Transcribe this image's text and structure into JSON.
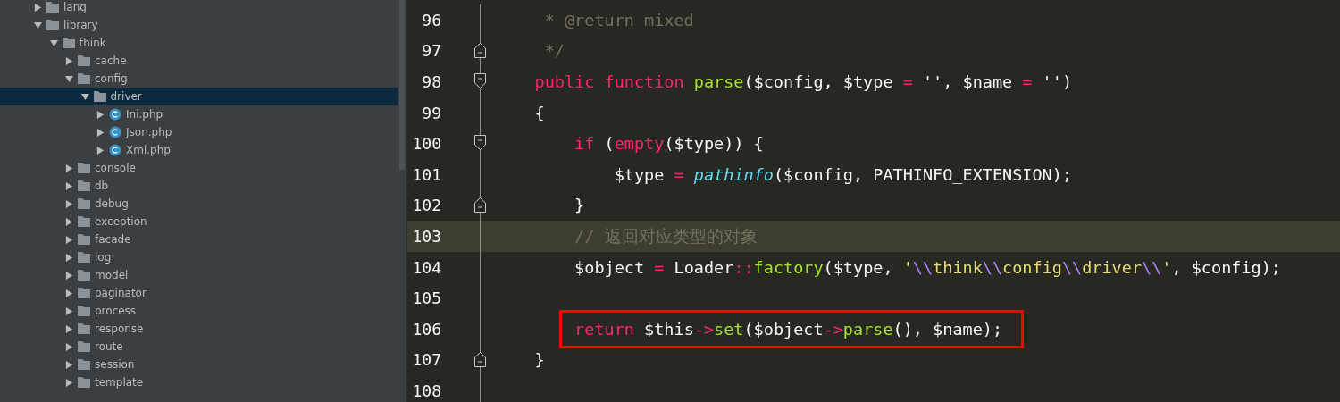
{
  "project_tree": [
    {
      "label": "lang",
      "kind": "folder",
      "expanded": false,
      "selected": false
    },
    {
      "label": "library",
      "kind": "folder",
      "expanded": true,
      "selected": false,
      "children": [
        {
          "label": "think",
          "kind": "folder",
          "expanded": true,
          "selected": false,
          "children": [
            {
              "label": "cache",
              "kind": "folder",
              "expanded": false,
              "selected": false
            },
            {
              "label": "config",
              "kind": "folder",
              "expanded": true,
              "selected": false,
              "children": [
                {
                  "label": "driver",
                  "kind": "folder",
                  "expanded": true,
                  "selected": true,
                  "children": [
                    {
                      "label": "Ini.php",
                      "kind": "class",
                      "expanded": false,
                      "selected": false
                    },
                    {
                      "label": "Json.php",
                      "kind": "class",
                      "expanded": false,
                      "selected": false
                    },
                    {
                      "label": "Xml.php",
                      "kind": "class",
                      "expanded": false,
                      "selected": false
                    }
                  ]
                }
              ]
            },
            {
              "label": "console",
              "kind": "folder",
              "expanded": false,
              "selected": false
            },
            {
              "label": "db",
              "kind": "folder",
              "expanded": false,
              "selected": false
            },
            {
              "label": "debug",
              "kind": "folder",
              "expanded": false,
              "selected": false
            },
            {
              "label": "exception",
              "kind": "folder",
              "expanded": false,
              "selected": false
            },
            {
              "label": "facade",
              "kind": "folder",
              "expanded": false,
              "selected": false
            },
            {
              "label": "log",
              "kind": "folder",
              "expanded": false,
              "selected": false
            },
            {
              "label": "model",
              "kind": "folder",
              "expanded": false,
              "selected": false
            },
            {
              "label": "paginator",
              "kind": "folder",
              "expanded": false,
              "selected": false
            },
            {
              "label": "process",
              "kind": "folder",
              "expanded": false,
              "selected": false
            },
            {
              "label": "response",
              "kind": "folder",
              "expanded": false,
              "selected": false
            },
            {
              "label": "route",
              "kind": "folder",
              "expanded": false,
              "selected": false
            },
            {
              "label": "session",
              "kind": "folder",
              "expanded": false,
              "selected": false
            },
            {
              "label": "template",
              "kind": "folder",
              "expanded": false,
              "selected": false
            }
          ]
        }
      ]
    }
  ],
  "editor": {
    "lines": [
      {
        "number": "96",
        "kind": "plain",
        "current": false,
        "boxed": false,
        "tokens": [
          {
            "text": "     * @return mixed",
            "kind": "comment"
          }
        ]
      },
      {
        "number": "97",
        "kind": "fold-end",
        "current": false,
        "boxed": false,
        "tokens": [
          {
            "text": "     */",
            "kind": "comment"
          }
        ]
      },
      {
        "number": "98",
        "kind": "fold-start",
        "current": false,
        "boxed": false,
        "tokens": [
          {
            "text": "    public function",
            "kind": "keyword"
          },
          {
            "text": " parse",
            "kind": "function"
          },
          {
            "text": "($config, $type ",
            "kind": "plain"
          },
          {
            "text": "=",
            "kind": "keyword"
          },
          {
            "text": " '', $name ",
            "kind": "plain"
          },
          {
            "text": "=",
            "kind": "keyword"
          },
          {
            "text": " '')",
            "kind": "plain"
          }
        ]
      },
      {
        "number": "99",
        "kind": "plain",
        "current": false,
        "boxed": false,
        "tokens": [
          {
            "text": "    {",
            "kind": "plain"
          }
        ]
      },
      {
        "number": "100",
        "kind": "fold-start",
        "current": false,
        "boxed": false,
        "tokens": [
          {
            "text": "        if",
            "kind": "keyword"
          },
          {
            "text": " (",
            "kind": "plain"
          },
          {
            "text": "empty",
            "kind": "keyword"
          },
          {
            "text": "($type)) {",
            "kind": "plain"
          }
        ]
      },
      {
        "number": "101",
        "kind": "plain",
        "current": false,
        "boxed": false,
        "tokens": [
          {
            "text": "            $type ",
            "kind": "plain"
          },
          {
            "text": "=",
            "kind": "keyword"
          },
          {
            "text": " pathinfo",
            "kind": "builtin"
          },
          {
            "text": "($config, PATHINFO_EXTENSION);",
            "kind": "plain"
          }
        ]
      },
      {
        "number": "102",
        "kind": "fold-end",
        "current": false,
        "boxed": false,
        "tokens": [
          {
            "text": "        }",
            "kind": "plain"
          }
        ]
      },
      {
        "number": "103",
        "kind": "plain",
        "current": true,
        "boxed": false,
        "tokens": [
          {
            "text": "        // 返回对应类型的对象",
            "kind": "comment"
          }
        ]
      },
      {
        "number": "104",
        "kind": "plain",
        "current": false,
        "boxed": false,
        "tokens": [
          {
            "text": "        $object ",
            "kind": "plain"
          },
          {
            "text": "=",
            "kind": "keyword"
          },
          {
            "text": " Loader",
            "kind": "plain"
          },
          {
            "text": "::",
            "kind": "keyword"
          },
          {
            "text": "factory",
            "kind": "function"
          },
          {
            "text": "($type, ",
            "kind": "plain"
          },
          {
            "text": "'",
            "kind": "string"
          },
          {
            "text": "\\\\",
            "kind": "escape"
          },
          {
            "text": "think",
            "kind": "string"
          },
          {
            "text": "\\\\",
            "kind": "escape"
          },
          {
            "text": "config",
            "kind": "string"
          },
          {
            "text": "\\\\",
            "kind": "escape"
          },
          {
            "text": "driver",
            "kind": "string"
          },
          {
            "text": "\\\\",
            "kind": "escape"
          },
          {
            "text": "'",
            "kind": "string"
          },
          {
            "text": ", $config);",
            "kind": "plain"
          }
        ]
      },
      {
        "number": "105",
        "kind": "plain",
        "current": false,
        "boxed": false
      },
      {
        "number": "106",
        "kind": "plain",
        "current": false,
        "boxed": true,
        "tokens": [
          {
            "text": "        return",
            "kind": "keyword"
          },
          {
            "text": " $this",
            "kind": "plain"
          },
          {
            "text": "->",
            "kind": "keyword"
          },
          {
            "text": "set",
            "kind": "function"
          },
          {
            "text": "($object",
            "kind": "plain"
          },
          {
            "text": "->",
            "kind": "keyword"
          },
          {
            "text": "parse",
            "kind": "function"
          },
          {
            "text": "(), $name);",
            "kind": "plain"
          }
        ]
      },
      {
        "number": "107",
        "kind": "fold-end",
        "current": false,
        "boxed": false,
        "tokens": [
          {
            "text": "    }",
            "kind": "plain"
          }
        ]
      },
      {
        "number": "108",
        "kind": "plain",
        "current": false,
        "boxed": false
      }
    ]
  }
}
